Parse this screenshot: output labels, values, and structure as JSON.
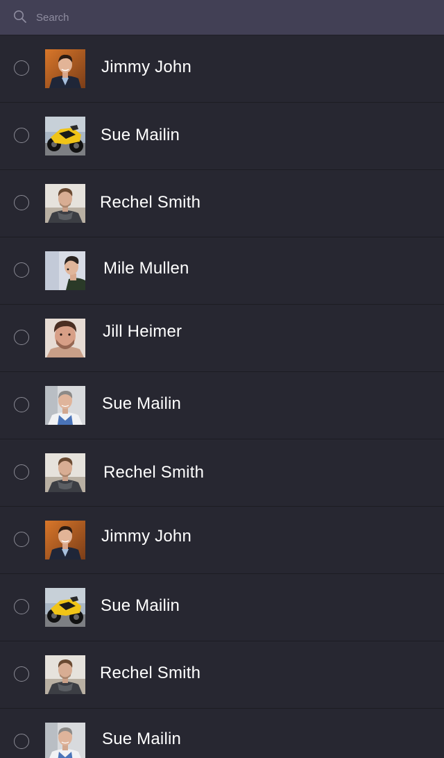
{
  "search": {
    "placeholder": "Search",
    "icon": "search-icon"
  },
  "contacts": [
    {
      "name": "Jimmy John",
      "avatar": "man-suit-photo",
      "selected": false
    },
    {
      "name": "Sue Mailin",
      "avatar": "motorcycle-photo",
      "selected": false
    },
    {
      "name": "Rechel Smith",
      "avatar": "man-scarf-photo",
      "selected": false
    },
    {
      "name": "Mile Mullen",
      "avatar": "man-profile-photo",
      "selected": false
    },
    {
      "name": "Jill Heimer",
      "avatar": "man-beard-photo",
      "selected": false
    },
    {
      "name": "Sue Mailin",
      "avatar": "man-grey-hair-photo",
      "selected": false
    },
    {
      "name": "Rechel Smith",
      "avatar": "man-scarf-photo",
      "selected": false
    },
    {
      "name": "Jimmy John",
      "avatar": "man-suit-photo",
      "selected": false
    },
    {
      "name": "Sue Mailin",
      "avatar": "motorcycle-photo",
      "selected": false
    },
    {
      "name": "Rechel Smith",
      "avatar": "man-scarf-photo",
      "selected": false
    },
    {
      "name": "Sue Mailin",
      "avatar": "man-grey-hair-photo",
      "selected": false
    }
  ]
}
